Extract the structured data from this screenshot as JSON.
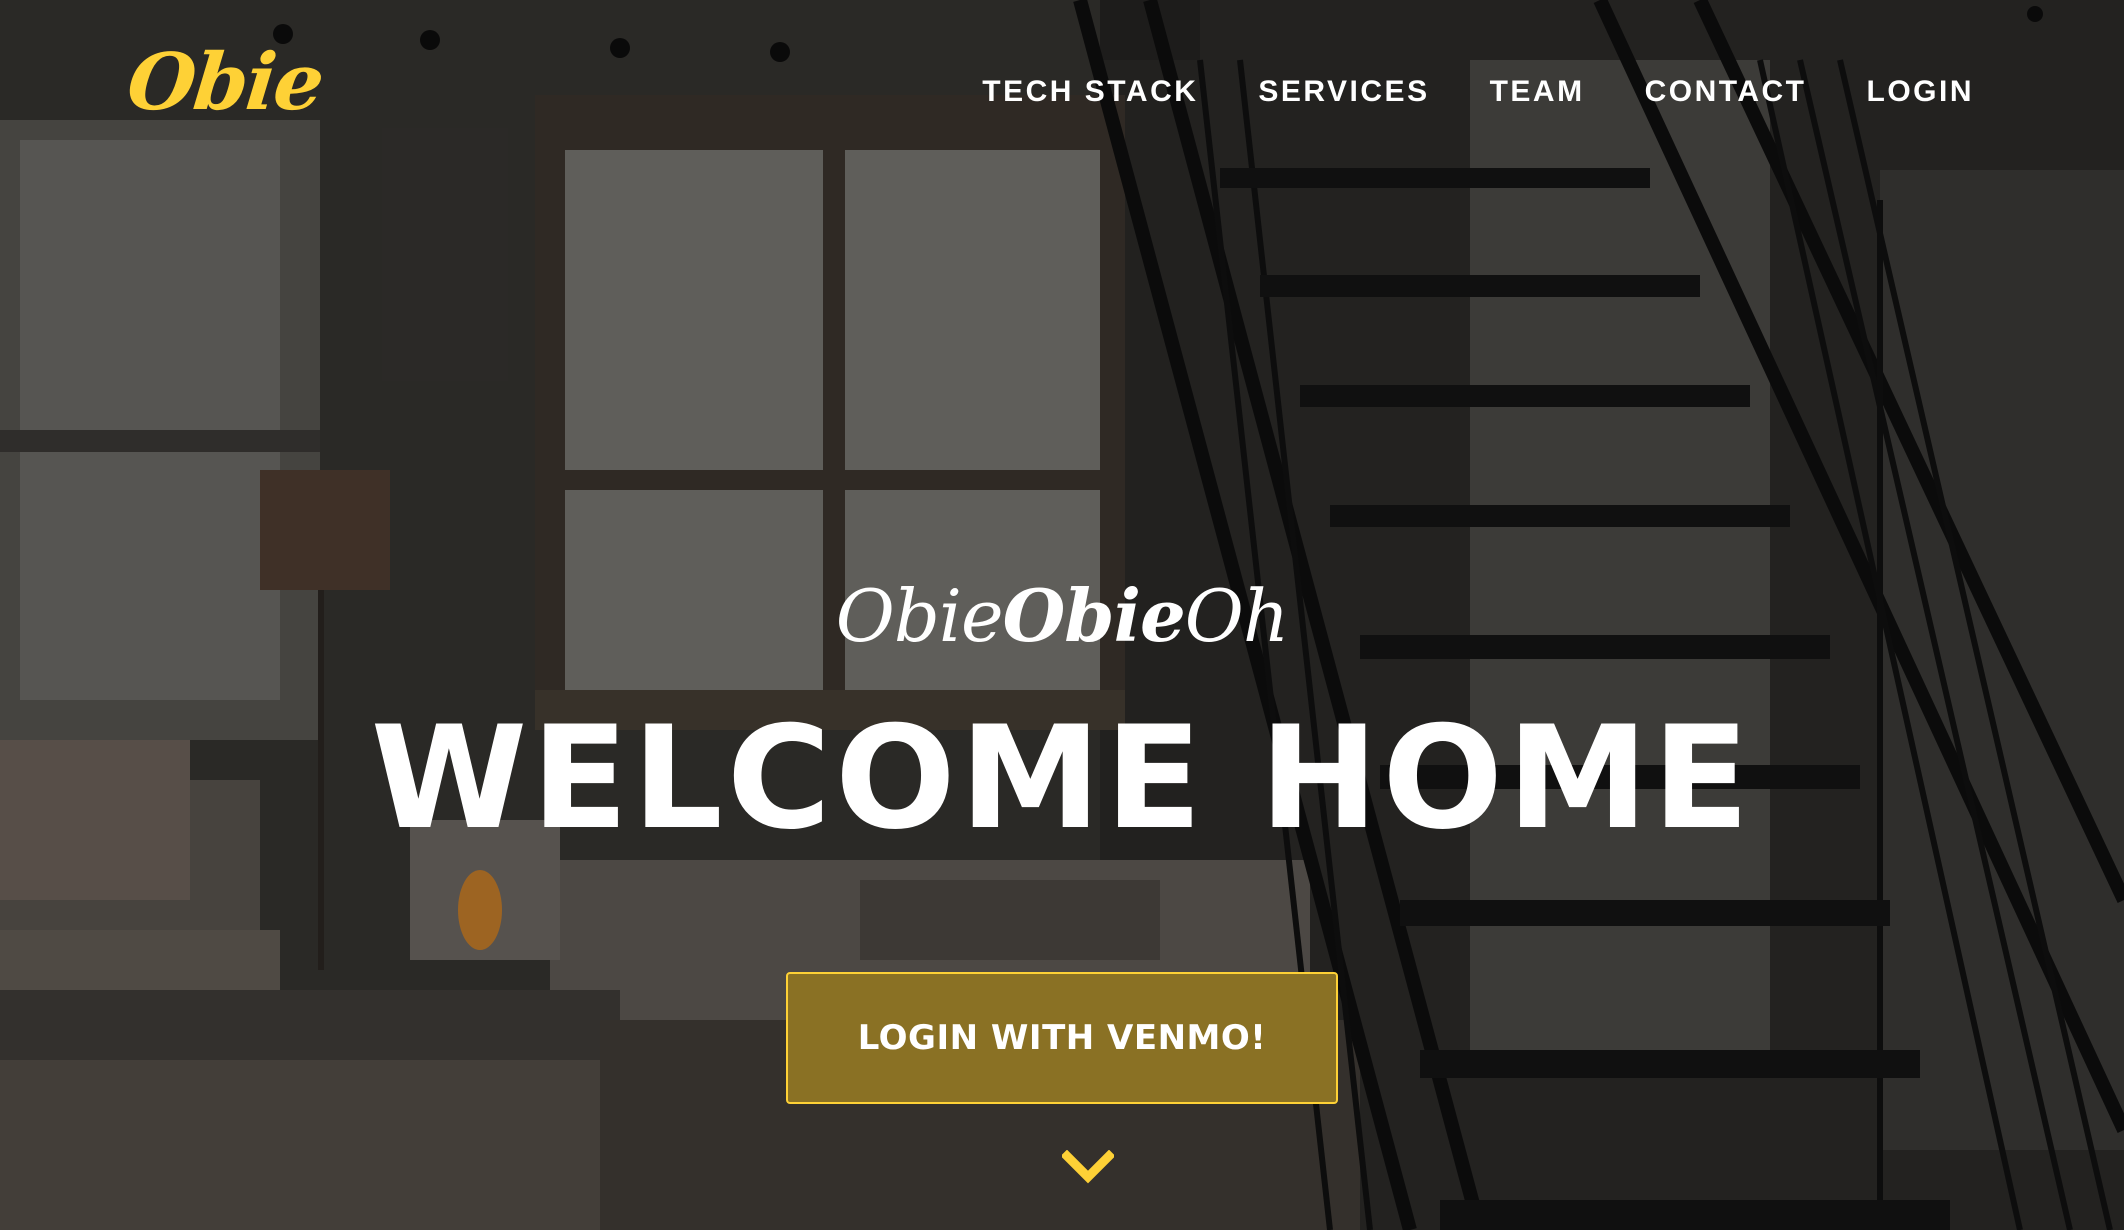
{
  "brand": {
    "name": "Obie"
  },
  "nav": {
    "items": [
      {
        "label": "TECH STACK"
      },
      {
        "label": "SERVICES"
      },
      {
        "label": "TEAM"
      },
      {
        "label": "CONTACT"
      },
      {
        "label": "LOGIN"
      }
    ]
  },
  "hero": {
    "subheading_regular_1": "Obie",
    "subheading_bold": "Obie",
    "subheading_regular_2": "Oh",
    "heading": "WELCOME HOME",
    "cta_label": "LOGIN WITH VENMO!",
    "scroll_icon": "chevron-down-icon",
    "background": "loft living room with staircase"
  },
  "colors": {
    "accent": "#fed136",
    "button_fill": "#8a7124",
    "button_border": "#fed136",
    "text": "#ffffff"
  }
}
